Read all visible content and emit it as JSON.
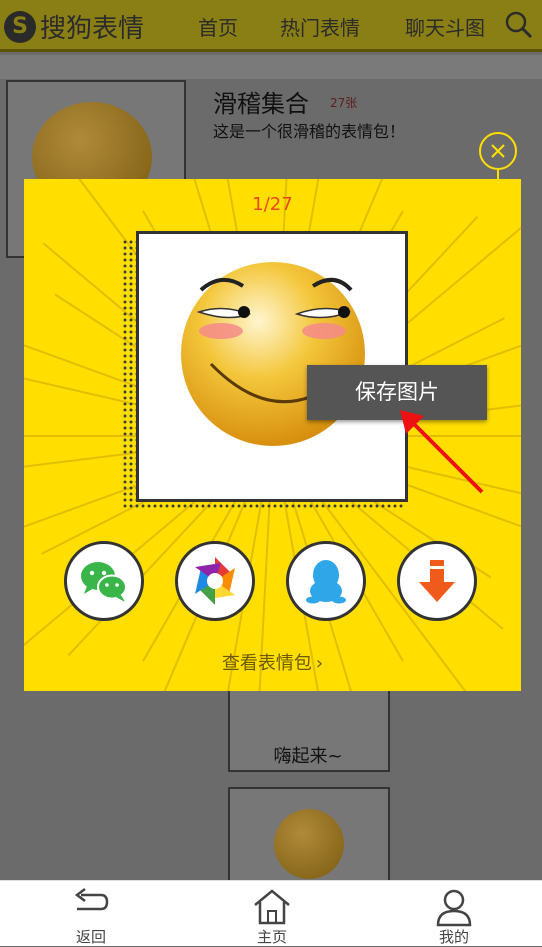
{
  "header": {
    "logo_text": "搜狗表情",
    "nav": [
      "首页",
      "热门表情",
      "聊天斗图"
    ]
  },
  "pack": {
    "title": "滑稽集合",
    "count": "27张",
    "description": "这是一个很滑稽的表情包！",
    "caption": "嗨起来~"
  },
  "popup": {
    "page_indicator": "1/27",
    "tooltip": "保存图片",
    "view_pack_link": "查看表情包",
    "share_buttons": [
      {
        "name": "wechat",
        "icon": "wechat-icon",
        "color": "#39b54a"
      },
      {
        "name": "moments",
        "icon": "camera-aperture-icon",
        "color": "#f2a20c"
      },
      {
        "name": "qq",
        "icon": "qq-penguin-icon",
        "color": "#2fa6e8"
      },
      {
        "name": "download",
        "icon": "download-arrow-icon",
        "color": "#f05a1a"
      }
    ]
  },
  "bottom_nav": {
    "back": "返回",
    "home": "主页",
    "mine": "我的"
  },
  "colors": {
    "popup_bg": "#ffde00",
    "page_indicator": "#e8491d",
    "overlay": "#6b6b6b"
  }
}
